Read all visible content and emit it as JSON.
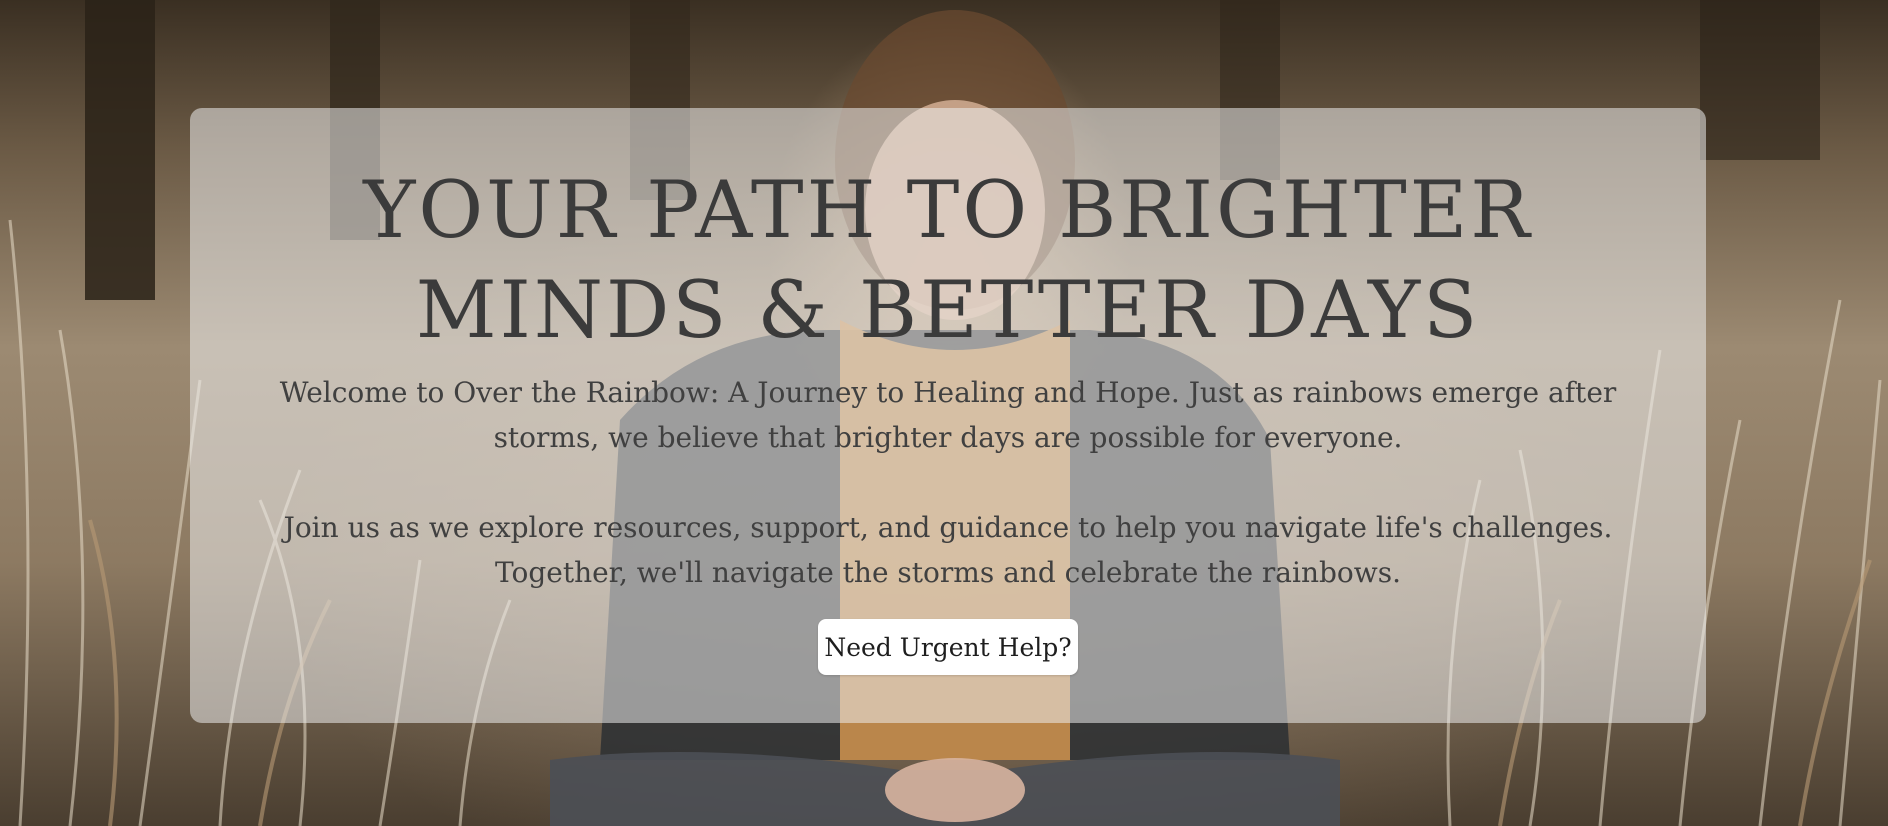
{
  "hero": {
    "headline_line1": "YOUR PATH TO BRIGHTER",
    "headline_line2": "MINDS & BETTER DAYS",
    "paragraph1": "Welcome to Over the Rainbow: A Journey to Healing and Hope. Just as rainbows emerge after storms, we believe that brighter days are possible for everyone.",
    "paragraph2": "Join us as we explore resources, support, and guidance to help you navigate life's challenges. Together, we'll navigate the storms and celebrate the rainbows.",
    "button_label": "Need Urgent Help?",
    "background_image_subject": "woman-sitting-in-tall-grass-photo"
  },
  "colors": {
    "card_background": "#ececec",
    "text": "#3b3b3b",
    "button_background": "#ffffff"
  }
}
